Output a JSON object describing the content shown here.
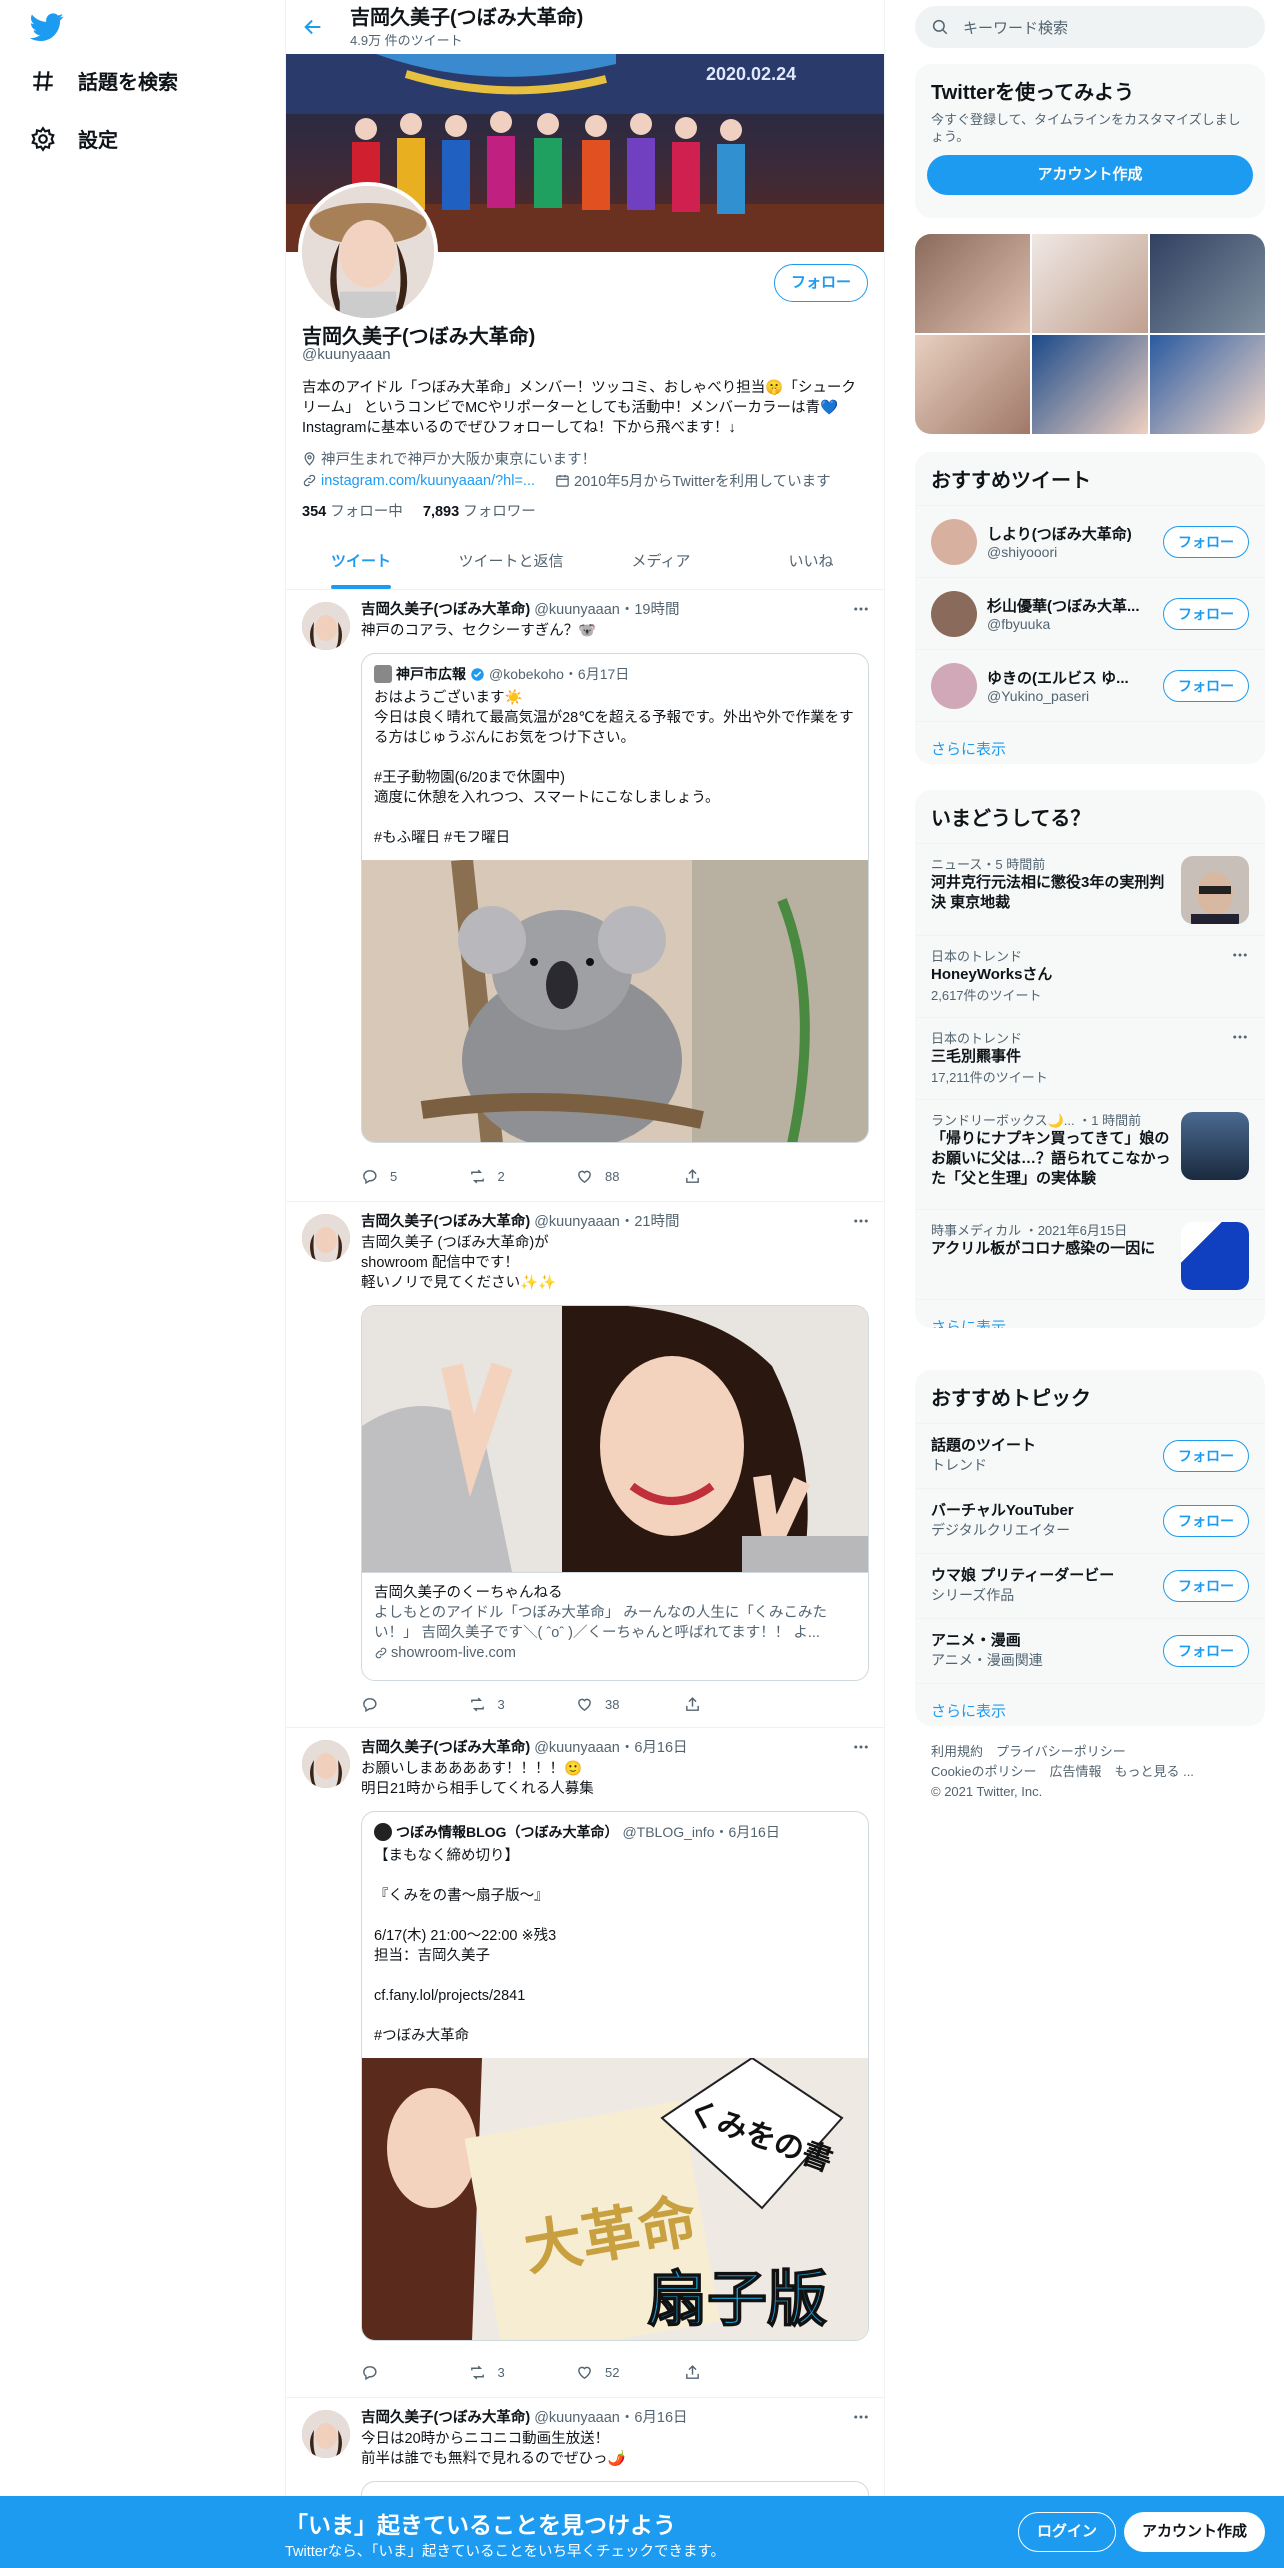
{
  "nav": {
    "explore": "話題を検索",
    "settings": "設定"
  },
  "header": {
    "name": "吉岡久美子(つぼみ大革命)",
    "tweet_count": "4.9万 件のツイート"
  },
  "banner": {
    "text": "2020.02.24"
  },
  "profile": {
    "name": "吉岡久美子(つぼみ大革命)",
    "handle": "@kuunyaaan",
    "follow_label": "フォロー",
    "bio": "吉本のアイドル「つぼみ大革命」メンバー！ツッコミ、おしゃべり担当🤫「シュークリーム」 というコンビでMCやリポーターとしても活動中！メンバーカラーは青💙 Instagramに基本いるのでぜひフォローしてね！下から飛べます！↓",
    "location": "神戸生まれで神戸か大阪か東京にいます！",
    "link": "instagram.com/kuunyaaan/?hl=...",
    "joined": "2010年5月からTwitterを利用しています",
    "following_count": "354",
    "following_label": "フォロー中",
    "followers_count": "7,893",
    "followers_label": "フォロワー"
  },
  "tabs": [
    "ツイート",
    "ツイートと返信",
    "メディア",
    "いいね"
  ],
  "tweets": [
    {
      "name": "吉岡久美子(つぼみ大革命)",
      "meta": "@kuunyaaan・19時間",
      "text": "神戸のコアラ、セクシーすぎん？🐨",
      "quote": {
        "name": "神戸市広報",
        "meta": "@kobekoho・6月17日",
        "text": "おはようございます☀️\n今日は良く晴れて最高気温が28℃を超える予報です。外出や外で作業をする方はじゅうぶんにお気をつけ下さい。\n\n#王子動物園(6/20まで休園中)\n適度に休憩を入れつつ、スマートにこなしましょう。\n\n#もふ曜日 #モフ曜日"
      },
      "replies": "5",
      "retweets": "2",
      "likes": "88"
    },
    {
      "name": "吉岡久美子(つぼみ大革命)",
      "meta": "@kuunyaaan・21時間",
      "text": "吉岡久美子 (つぼみ大革命)が\nshowroom 配信中です！\n軽いノリで見てください✨✨",
      "link_card": {
        "title": "吉岡久美子のくーちゃんねる",
        "desc": "よしもとのアイドル「つぼみ大革命」 みーんなの人生に「くみこみたい！」 吉岡久美子です＼( ˆoˆ )／くーちゃんと呼ばれてます！！ よ...",
        "url": "showroom-live.com"
      },
      "replies": "",
      "retweets": "3",
      "likes": "38"
    },
    {
      "name": "吉岡久美子(つぼみ大革命)",
      "meta": "@kuunyaaan・6月16日",
      "text": "お願いしまああああす！！！！🙂\n明日21時から相手してくれる人募集",
      "quote": {
        "name": "つぼみ情報BLOG（つぼみ大革命）",
        "meta": "@TBLOG_info・6月16日",
        "text": "【まもなく締め切り】\n\n『くみをの書～扇子版～』\n\n6/17(木) 21:00～22:00 ※残3\n担当：吉岡久美子\n\ncf.fany.lol/projects/2841\n\n#つぼみ大革命"
      },
      "image_text": {
        "fan": "くみをの書",
        "sub": "扇子版",
        "shikishi": "大革命"
      },
      "replies": "",
      "retweets": "3",
      "likes": "52"
    },
    {
      "name": "吉岡久美子(つぼみ大革命)",
      "meta": "@kuunyaaan・6月16日",
      "text": "今日は20時からニコニコ動画生放送！\n前半は誰でも無料で見れるのでぜひっ🌶️"
    }
  ],
  "right": {
    "search_placeholder": "キーワード検索",
    "signup": {
      "title": "Twitterを使ってみよう",
      "sub": "今すぐ登録して、タイムラインをカスタマイズしましょう。",
      "button": "アカウント作成"
    },
    "who": {
      "title": "おすすめツイート",
      "items": [
        {
          "name": "しより(つぼみ大革命)",
          "handle": "@shiyooori",
          "button": "フォロー"
        },
        {
          "name": "杉山優華(つぼみ大革...",
          "handle": "@fbyuuka",
          "button": "フォロー"
        },
        {
          "name": "ゆきの(エルビス ゆ...",
          "handle": "@Yukino_paseri",
          "button": "フォロー"
        }
      ],
      "more": "さらに表示"
    },
    "trends": {
      "title": "いまどうしてる？",
      "items": [
        {
          "context": "ニュース・5 時間前",
          "title": "河井克行元法相に懲役3年の実刑判決 東京地裁",
          "count": ""
        },
        {
          "context": "日本のトレンド",
          "title": "HoneyWorksさん",
          "count": "2,617件のツイート"
        },
        {
          "context": "日本のトレンド",
          "title": "三毛別羆事件",
          "count": "17,211件のツイート"
        },
        {
          "context": "ランドリーボックス🌙... ・1 時間前",
          "title": "「帰りにナプキン買ってきて」娘のお願いに父は…？語られてこなかった「父と生理」の実体験",
          "count": ""
        },
        {
          "context": "時事メディカル ・2021年6月15日",
          "title": "アクリル板がコロナ感染の一因に",
          "count": ""
        }
      ],
      "more": "さらに表示"
    },
    "topics": {
      "title": "おすすめトピック",
      "items": [
        {
          "name": "話題のツイート",
          "sub": "トレンド",
          "button": "フォロー"
        },
        {
          "name": "バーチャルYouTuber",
          "sub": "デジタルクリエイター",
          "button": "フォロー"
        },
        {
          "name": "ウマ娘 プリティーダービー",
          "sub": "シリーズ作品",
          "button": "フォロー"
        },
        {
          "name": "アニメ・漫画",
          "sub": "アニメ・漫画関連",
          "button": "フォロー"
        }
      ],
      "more": "さらに表示"
    },
    "footer": {
      "line1": "利用規約　プライバシーポリシー",
      "line2": "Cookieのポリシー　広告情報　もっと見る ...",
      "line3": "© 2021 Twitter, Inc."
    }
  },
  "bottombar": {
    "title": "「いま」起きていることを見つけよう",
    "sub": "Twitterなら、「いま」起きていることをいち早くチェックできます。",
    "login": "ログイン",
    "signup": "アカウント作成"
  },
  "colors": {
    "accent": "#1d9bf0",
    "text": "#0f1419",
    "secondary": "#536471"
  }
}
